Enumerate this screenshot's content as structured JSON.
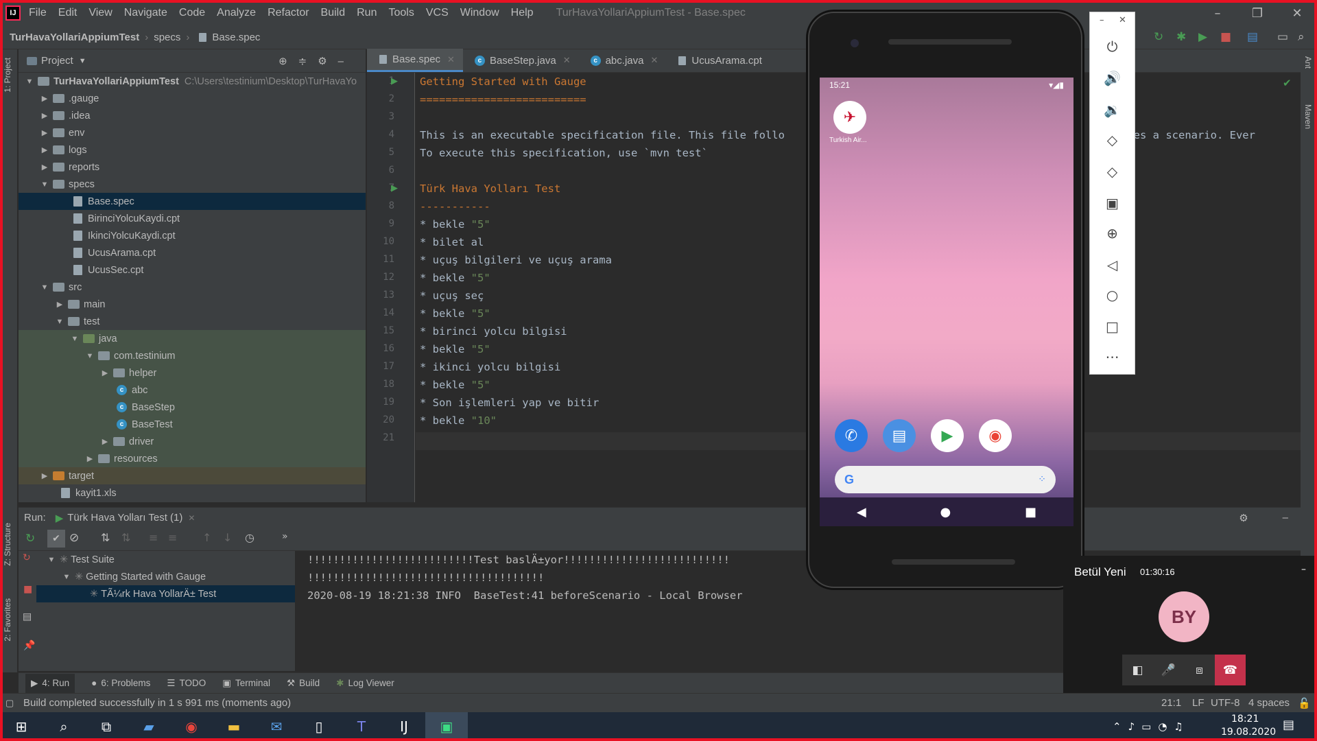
{
  "menu": {
    "items": [
      "File",
      "Edit",
      "View",
      "Navigate",
      "Code",
      "Analyze",
      "Refactor",
      "Build",
      "Run",
      "Tools",
      "VCS",
      "Window",
      "Help"
    ],
    "window_title": "TurHavaYollariAppiumTest - Base.spec"
  },
  "breadcrumb": {
    "project": "TurHavaYollariAppiumTest",
    "folder": "specs",
    "file": "Base.spec"
  },
  "project_panel": {
    "title": "Project",
    "root_name": "TurHavaYollariAppiumTest",
    "root_path": "C:\\Users\\testinium\\Desktop\\TurHavaYo",
    "items": [
      ".gauge",
      ".idea",
      "env",
      "logs",
      "reports",
      "specs",
      "Base.spec",
      "BirinciYolcuKaydi.cpt",
      "IkinciYolcuKaydi.cpt",
      "UcusArama.cpt",
      "UcusSec.cpt",
      "src",
      "main",
      "test",
      "java",
      "com.testinium",
      "helper",
      "abc",
      "BaseStep",
      "BaseTest",
      "driver",
      "resources",
      "target",
      "kayit1.xls"
    ]
  },
  "editor": {
    "tabs": [
      "Base.spec",
      "BaseStep.java",
      "abc.java",
      "UcusArama.cpt"
    ],
    "line_numbers": [
      "1",
      "2",
      "3",
      "4",
      "5",
      "6",
      "7",
      "8",
      "9",
      "10",
      "11",
      "12",
      "13",
      "14",
      "15",
      "16",
      "17",
      "18",
      "19",
      "20",
      "21"
    ],
    "lines": [
      "Getting Started with Gauge",
      "==========================",
      "",
      "This is an executable specification file. This file follo",
      "To execute this specification, use `mvn test`",
      "",
      "Türk Hava Yolları Test",
      "-----------",
      "* bekle ",
      "* bilet al",
      "* uçuş bilgileri ve uçuş arama",
      "* bekle ",
      "* uçuş seç",
      "* bekle ",
      "* birinci yolcu bilgisi",
      "* bekle ",
      "* ikinci yolcu bilgisi",
      "* bekle ",
      "* Son işlemleri yap ve bitir",
      "* bekle ",
      ""
    ],
    "quoted": {
      "l9": "\"5\"",
      "l12": "\"5\"",
      "l14": "\"5\"",
      "l16": "\"5\"",
      "l18": "\"5\"",
      "l20": "\"10\""
    },
    "right_overflow_text": "denotes a scenario. Ever"
  },
  "run_panel": {
    "label": "Run:",
    "tab": "Türk Hava Yolları Test (1)",
    "tree": [
      "Test Suite",
      "Getting Started with Gauge",
      "TÃ¼rk Hava YollarÄ± Test"
    ],
    "console": [
      "!!!!!!!!!!!!!!!!!!!!!!!!!!Test baslÄ±yor!!!!!!!!!!!!!!!!!!!!!!!!!!",
      "!!!!!!!!!!!!!!!!!!!!!!!!!!!!!!!!!!!!!",
      "2020-08-19 18:21:38 INFO  BaseTest:41 beforeScenario - Local Browser"
    ]
  },
  "bottom_tabs": [
    "4: Run",
    "6: Problems",
    "TODO",
    "Terminal",
    "Build",
    "Log Viewer"
  ],
  "status": {
    "message": "Build completed successfully in 1 s 991 ms (moments ago)",
    "position": "21:1",
    "line_sep": "LF",
    "encoding": "UTF-8",
    "indent": "4 spaces"
  },
  "left_stripe": [
    "1: Project",
    "Z: Structure",
    "2: Favorites"
  ],
  "right_stripe": [
    "Ant",
    "Maven"
  ],
  "phone": {
    "time": "15:21",
    "app_label": "Turkish Air..."
  },
  "teams": {
    "name": "Betül Yeni",
    "timer": "01:30:16",
    "initials": "BY"
  },
  "taskbar": {
    "time": "18:21",
    "date": "19.08.2020"
  },
  "colors": {
    "accent": "#4a88c7",
    "keyword": "#cc7832",
    "string": "#6a8759",
    "frame": "#e81123"
  }
}
